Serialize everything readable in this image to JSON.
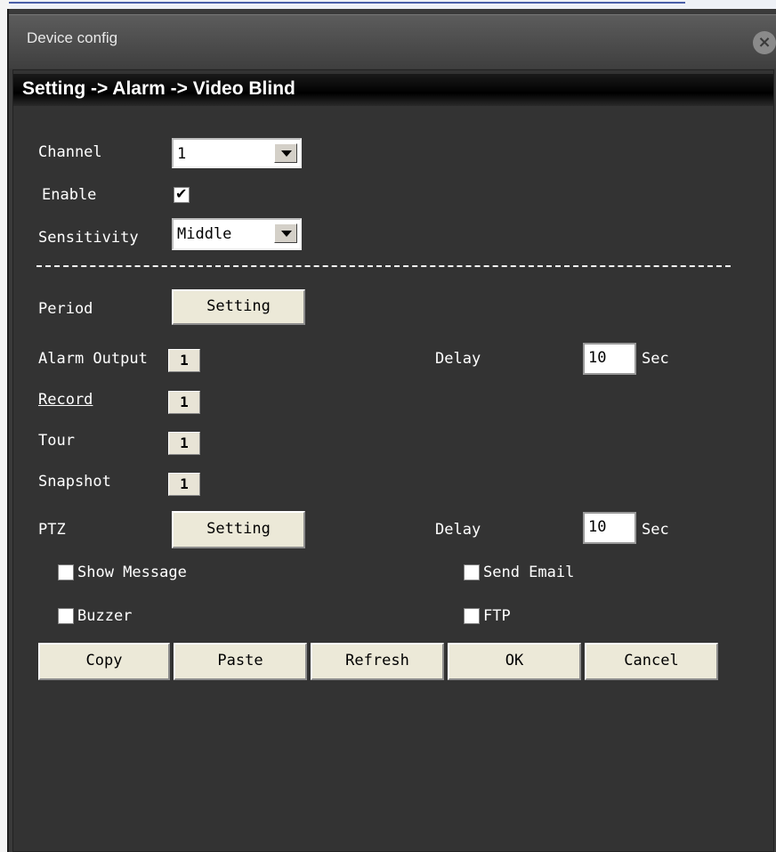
{
  "window": {
    "title": "Device config"
  },
  "header": {
    "breadcrumb": "Setting -> Alarm -> Video Blind"
  },
  "form": {
    "channel_label": "Channel",
    "channel_value": "1",
    "enable_label": "Enable",
    "enable_checked": true,
    "sensitivity_label": "Sensitivity",
    "sensitivity_value": "Middle",
    "period_label": "Period",
    "period_button": "Setting",
    "alarm_output_label": "Alarm Output",
    "alarm_output_value": "1",
    "delay_label": "Delay",
    "delay_value": "10",
    "delay_unit": "Sec",
    "record_label": "Record",
    "record_value": "1",
    "tour_label": "Tour",
    "tour_value": "1",
    "snapshot_label": "Snapshot",
    "snapshot_value": "1",
    "ptz_label": "PTZ",
    "ptz_button": "Setting",
    "ptz_delay_label": "Delay",
    "ptz_delay_value": "10",
    "ptz_delay_unit": "Sec",
    "show_message_label": "Show Message",
    "send_email_label": "Send Email",
    "buzzer_label": "Buzzer",
    "ftp_label": "FTP"
  },
  "buttons": {
    "copy": "Copy",
    "paste": "Paste",
    "refresh": "Refresh",
    "ok": "OK",
    "cancel": "Cancel"
  },
  "icons": {
    "close": "close-icon",
    "dropdown": "chevron-down-icon",
    "check": "check-icon"
  }
}
